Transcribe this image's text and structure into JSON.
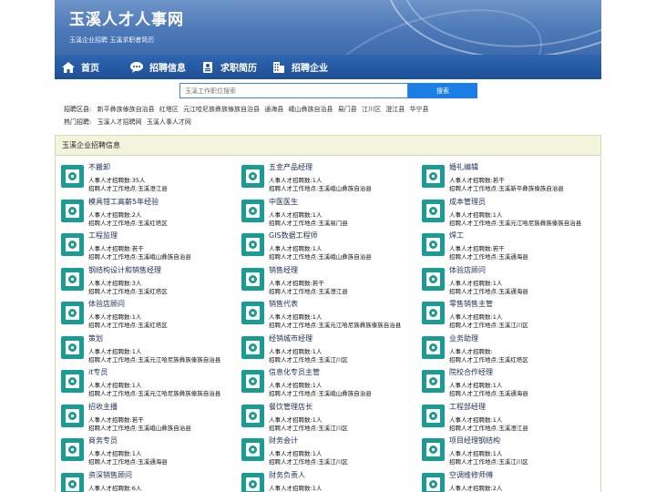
{
  "site": {
    "title": "玉溪人才人事网",
    "subtitle": "玉溪企业招聘 玉溪求职者简历"
  },
  "nav": [
    {
      "label": "首页",
      "icon": "home-icon"
    },
    {
      "label": "招聘信息",
      "icon": "chat-icon"
    },
    {
      "label": "求职简历",
      "icon": "resume-icon"
    },
    {
      "label": "招聘企业",
      "icon": "building-icon"
    }
  ],
  "search": {
    "placeholder": "玉溪工作职位搜索",
    "button": "搜索"
  },
  "areas": {
    "label": "招聘区县:",
    "items": [
      "新平彝族傣族自治县",
      "红塔区",
      "元江哈尼族彝族傣族自治县",
      "通海县",
      "峨山彝族自治县",
      "易门县",
      "江川区",
      "澄江县",
      "华宁县"
    ]
  },
  "hot": {
    "label": "热门招聘:",
    "items": [
      "玉溪人才招聘网",
      "玉溪人事人才网"
    ]
  },
  "section": {
    "title": "玉溪企业招聘信息"
  },
  "count_prefix": "人事人才招聘数:",
  "location_prefix": "招聘人才工作地点:",
  "jobs": [
    {
      "title": "不搬卸",
      "count": "35人",
      "location": "玉溪澄江县"
    },
    {
      "title": "五金产品经理",
      "count": "1人",
      "location": "玉溪峨山彝族自治县"
    },
    {
      "title": "婚礼编辑",
      "count": "若干",
      "location": "玉溪新平彝族傣族自治县"
    },
    {
      "title": "模具钳工高薪5年经验",
      "count": "2人",
      "location": "玉溪红塔区"
    },
    {
      "title": "中医医生",
      "count": "1人",
      "location": "玉溪易门县"
    },
    {
      "title": "成本管理员",
      "count": "1人",
      "location": "玉溪元江哈尼族彝族傣族自治县"
    },
    {
      "title": "工程监理",
      "count": "若干",
      "location": "玉溪峨山彝族自治县"
    },
    {
      "title": "GIS数据工程师",
      "count": "1人",
      "location": "玉溪峨山彝族自治县"
    },
    {
      "title": "焊工",
      "count": "若干",
      "location": "玉溪通海县"
    },
    {
      "title": "钢结构设计和销售经理",
      "count": "3人",
      "location": "玉溪红塔区"
    },
    {
      "title": "销售经理",
      "count": "若干",
      "location": "玉溪澄江县"
    },
    {
      "title": "体验店顾问",
      "count": "1人",
      "location": "玉溪通海县"
    },
    {
      "title": "体验店顾问",
      "count": "1人",
      "location": "玉溪红塔区"
    },
    {
      "title": "销售代表",
      "count": "1人",
      "location": "玉溪元江哈尼族彝族傣族自治县"
    },
    {
      "title": "零售销售主管",
      "count": "1人",
      "location": "玉溪江川区"
    },
    {
      "title": "策划",
      "count": "1人",
      "location": "玉溪元江哈尼族彝族傣族自治县"
    },
    {
      "title": "经销城市经理",
      "count": "1人",
      "location": "玉溪江川区"
    },
    {
      "title": "业务助理",
      "count": "",
      "location": "玉溪红塔区"
    },
    {
      "title": "it专员",
      "count": "1人",
      "location": "玉溪元江哈尼族彝族傣族自治县"
    },
    {
      "title": "信息化专员主管",
      "count": "1人",
      "location": "玉溪峨山彝族自治县"
    },
    {
      "title": "院校合作经理",
      "count": "1人",
      "location": "玉溪通海县"
    },
    {
      "title": "招收主播",
      "count": "若干",
      "location": "玉溪峨山彝族自治县"
    },
    {
      "title": "餐饮管理店长",
      "count": "1人",
      "location": "玉溪江川区"
    },
    {
      "title": "工程部经理",
      "count": "1人",
      "location": "玉溪澄江县"
    },
    {
      "title": "商务专员",
      "count": "1人",
      "location": "玉溪通海县"
    },
    {
      "title": "财务会计",
      "count": "1人",
      "location": "玉溪江川区"
    },
    {
      "title": "项目经理钢结构",
      "count": "1人",
      "location": "玉溪江川区"
    },
    {
      "title": "资深销售顾问",
      "count": "6人",
      "location": ""
    },
    {
      "title": "财务负责人",
      "count": "1人",
      "location": ""
    },
    {
      "title": "空调维修师傅",
      "count": "2人",
      "location": ""
    }
  ],
  "colors": {
    "banner": "#4d79b8",
    "nav": "#1d4f96",
    "search_button": "#1a7ee6",
    "section_header": "#f4f4dd",
    "logo": "#1a9b93"
  }
}
